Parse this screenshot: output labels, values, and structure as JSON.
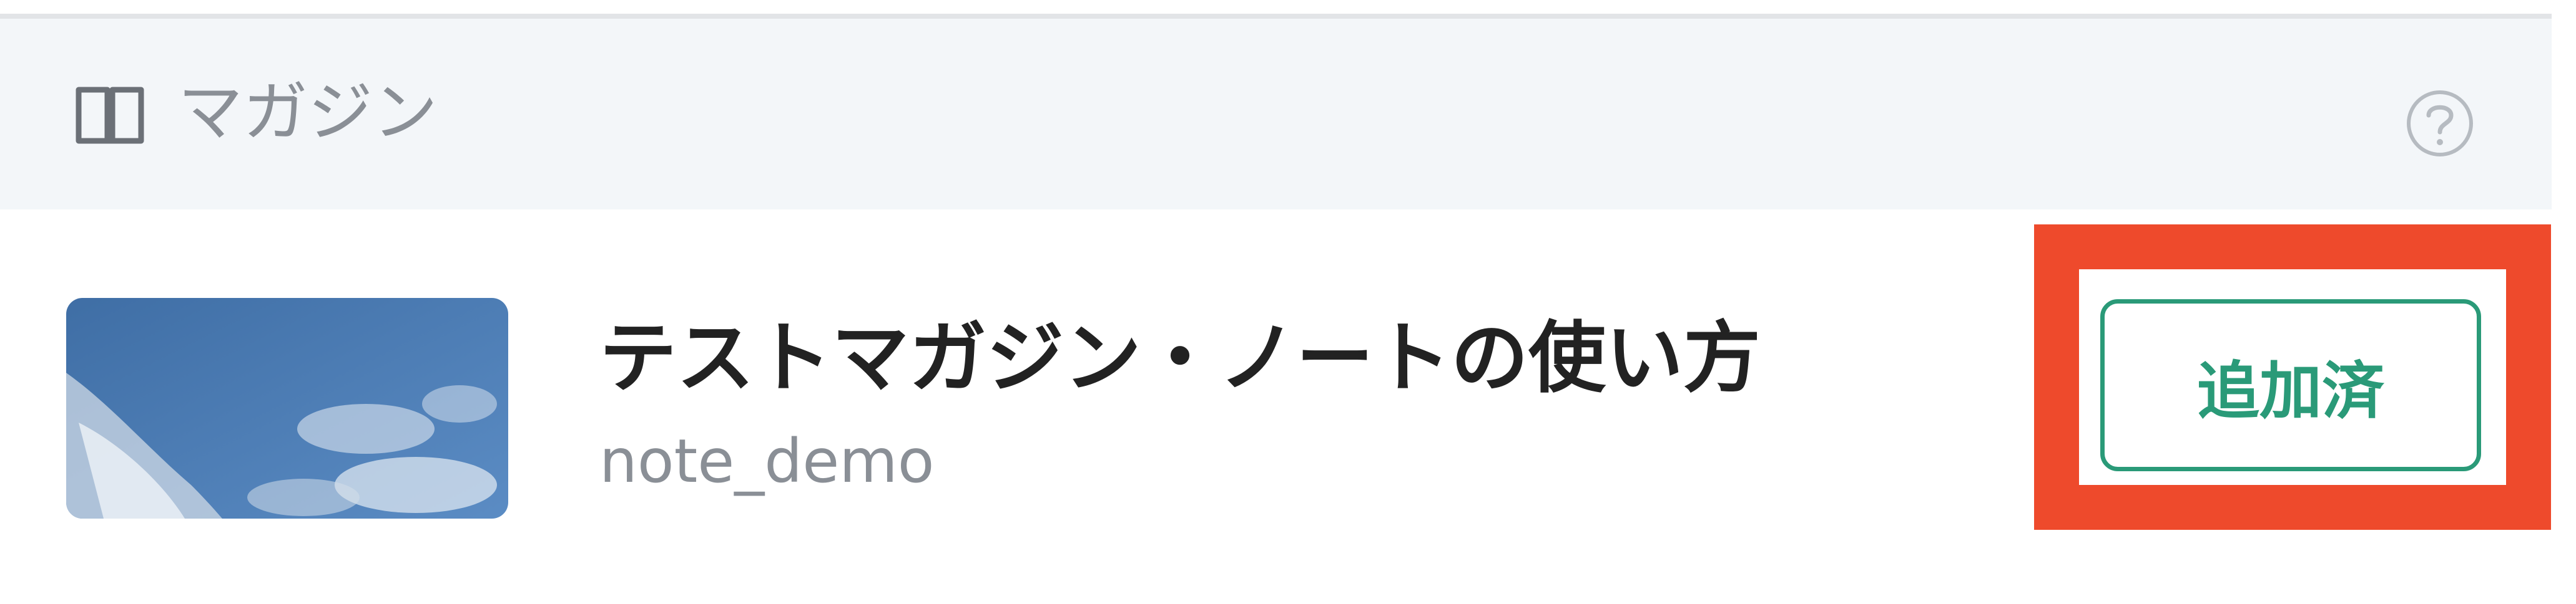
{
  "magazine_header": {
    "label": "マガジン",
    "icon": "book-icon",
    "help_icon": "help-icon"
  },
  "magazine": {
    "title": "テストマガジン・ノートの使い方",
    "owner": "note_demo",
    "thumbnail": "sky-thumbnail",
    "action_label": "追加済"
  },
  "colors": {
    "accent": "#2a9a78",
    "highlight": "#ee4a2c",
    "header_bg": "#f3f6f9"
  }
}
